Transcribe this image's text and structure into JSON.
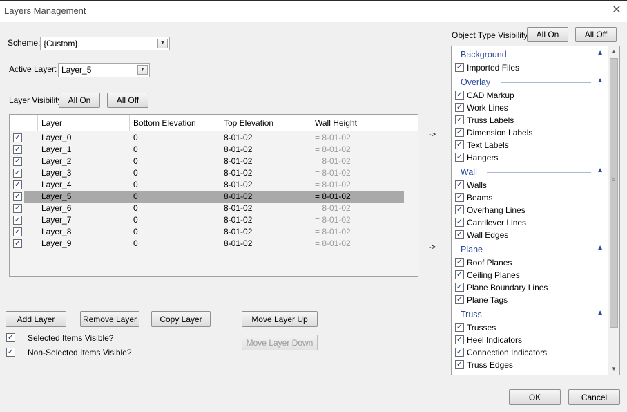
{
  "window": {
    "title": "Layers Management",
    "close_glyph": "✕"
  },
  "scheme": {
    "label": "Scheme:",
    "value": "{Custom}"
  },
  "active_layer": {
    "label": "Active Layer:",
    "value": "Layer_5"
  },
  "layer_visibility": {
    "label": "Layer Visibility:",
    "all_on": "All On",
    "all_off": "All Off"
  },
  "grid": {
    "columns": [
      "Layer",
      "Bottom Elevation",
      "Top Elevation",
      "Wall Height"
    ],
    "selected_index": 5,
    "rows": [
      {
        "checked": true,
        "layer": "Layer_0",
        "bottom": "0",
        "top": "8-01-02",
        "wall": "= 8-01-02"
      },
      {
        "checked": true,
        "layer": "Layer_1",
        "bottom": "0",
        "top": "8-01-02",
        "wall": "= 8-01-02"
      },
      {
        "checked": true,
        "layer": "Layer_2",
        "bottom": "0",
        "top": "8-01-02",
        "wall": "= 8-01-02"
      },
      {
        "checked": true,
        "layer": "Layer_3",
        "bottom": "0",
        "top": "8-01-02",
        "wall": "= 8-01-02"
      },
      {
        "checked": true,
        "layer": "Layer_4",
        "bottom": "0",
        "top": "8-01-02",
        "wall": "= 8-01-02"
      },
      {
        "checked": true,
        "layer": "Layer_5",
        "bottom": "0",
        "top": "8-01-02",
        "wall": "= 8-01-02"
      },
      {
        "checked": true,
        "layer": "Layer_6",
        "bottom": "0",
        "top": "8-01-02",
        "wall": "= 8-01-02"
      },
      {
        "checked": true,
        "layer": "Layer_7",
        "bottom": "0",
        "top": "8-01-02",
        "wall": "= 8-01-02"
      },
      {
        "checked": true,
        "layer": "Layer_8",
        "bottom": "0",
        "top": "8-01-02",
        "wall": "= 8-01-02"
      },
      {
        "checked": true,
        "layer": "Layer_9",
        "bottom": "0",
        "top": "8-01-02",
        "wall": "= 8-01-02"
      }
    ]
  },
  "arrows": {
    "top": "->",
    "bottom": "->"
  },
  "buttons": {
    "add_layer": "Add Layer",
    "remove_layer": "Remove Layer",
    "copy_layer": "Copy Layer",
    "move_up": "Move Layer Up",
    "move_down": "Move Layer Down",
    "ok": "OK",
    "cancel": "Cancel"
  },
  "options": {
    "selected_visible": {
      "label": "Selected Items Visible?",
      "checked": true
    },
    "non_selected_visible": {
      "label": "Non-Selected Items Visible?",
      "checked": true
    }
  },
  "object_type_visibility": {
    "label": "Object Type Visibility:",
    "all_on": "All On",
    "all_off": "All Off",
    "groups": [
      {
        "name": "Background",
        "collapse_glyph": "▲",
        "items": [
          {
            "label": "Imported Files",
            "checked": true
          }
        ]
      },
      {
        "name": "Overlay",
        "collapse_glyph": "▲",
        "items": [
          {
            "label": "CAD Markup",
            "checked": true
          },
          {
            "label": "Work Lines",
            "checked": true
          },
          {
            "label": "Truss Labels",
            "checked": true
          },
          {
            "label": "Dimension Labels",
            "checked": true
          },
          {
            "label": "Text Labels",
            "checked": true
          },
          {
            "label": "Hangers",
            "checked": true
          }
        ]
      },
      {
        "name": "Wall",
        "collapse_glyph": "▲",
        "items": [
          {
            "label": "Walls",
            "checked": true
          },
          {
            "label": "Beams",
            "checked": true
          },
          {
            "label": "Overhang Lines",
            "checked": true
          },
          {
            "label": "Cantilever Lines",
            "checked": true
          },
          {
            "label": "Wall Edges",
            "checked": true
          }
        ]
      },
      {
        "name": "Plane",
        "collapse_glyph": "▲",
        "items": [
          {
            "label": "Roof Planes",
            "checked": true
          },
          {
            "label": "Ceiling Planes",
            "checked": true
          },
          {
            "label": "Plane Boundary Lines",
            "checked": true
          },
          {
            "label": "Plane Tags",
            "checked": true
          }
        ]
      },
      {
        "name": "Truss",
        "collapse_glyph": "▲",
        "items": [
          {
            "label": "Trusses",
            "checked": true
          },
          {
            "label": "Heel Indicators",
            "checked": true
          },
          {
            "label": "Connection Indicators",
            "checked": true
          },
          {
            "label": "Truss Edges",
            "checked": true
          }
        ]
      }
    ]
  },
  "icons": {
    "close": "close-icon",
    "dropdown": "chevron-down-icon",
    "check": "checkmark-icon",
    "collapse": "chevron-up-icon",
    "scroll_up": "scroll-up-arrow-icon",
    "scroll_down": "scroll-down-arrow-icon"
  }
}
